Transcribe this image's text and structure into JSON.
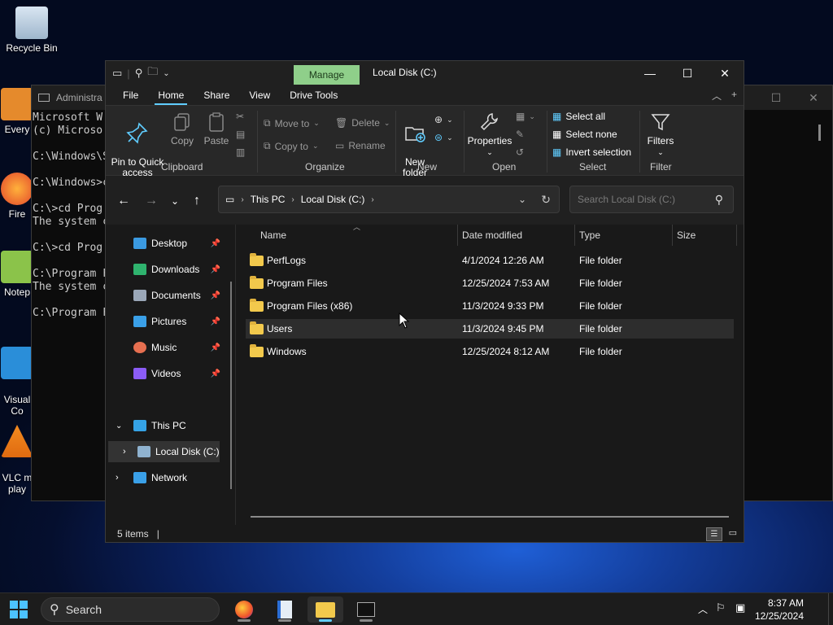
{
  "desktop": {
    "icons": [
      {
        "label": "Recycle Bin"
      },
      {
        "label": "Every"
      },
      {
        "label": "Fire"
      },
      {
        "label": "Notep"
      },
      {
        "label": "Visual\nCo"
      },
      {
        "label": "VLC m\nplay"
      }
    ]
  },
  "cmd": {
    "title": "Administra",
    "lines": "Microsoft W\n(c) Microso\n\nC:\\Windows\\S\n\nC:\\Windows>c\n\nC:\\>cd Prog\nThe system c\n\nC:\\>cd Prog\n\nC:\\Program F\nThe system c\n\nC:\\Program F"
  },
  "explorer": {
    "title": "Local Disk (C:)",
    "context_tab": "Manage",
    "menu": [
      "File",
      "Home",
      "Share",
      "View",
      "Drive Tools"
    ],
    "active_menu": "Home",
    "ribbon": {
      "clipboard": {
        "label": "Clipboard",
        "pin": "Pin to Quick\naccess",
        "copy": "Copy",
        "paste": "Paste"
      },
      "organize": {
        "label": "Organize",
        "move_to": "Move to",
        "copy_to": "Copy to",
        "delete": "Delete",
        "rename": "Rename"
      },
      "new": {
        "label": "New",
        "new_folder": "New\nfolder"
      },
      "open": {
        "label": "Open",
        "properties": "Properties"
      },
      "select": {
        "label": "Select",
        "select_all": "Select all",
        "select_none": "Select none",
        "invert": "Invert selection"
      },
      "filter": {
        "label": "Filter",
        "filters": "Filters"
      }
    },
    "address": {
      "crumbs": [
        "This PC",
        "Local Disk (C:)"
      ]
    },
    "search_placeholder": "Search Local Disk (C:)",
    "nav": {
      "quick": [
        {
          "label": "Desktop",
          "color": "#3b9ae1"
        },
        {
          "label": "Downloads",
          "color": "#2fb36e"
        },
        {
          "label": "Documents",
          "color": "#9aa7b8"
        },
        {
          "label": "Pictures",
          "color": "#3aa0e8"
        },
        {
          "label": "Music",
          "color": "#e66f50"
        },
        {
          "label": "Videos",
          "color": "#8b5cf6"
        }
      ],
      "this_pc": "This PC",
      "local_disk": "Local Disk (C:)",
      "network": "Network"
    },
    "columns": [
      "Name",
      "Date modified",
      "Type",
      "Size"
    ],
    "files": [
      {
        "name": "PerfLogs",
        "date": "4/1/2024 12:26 AM",
        "type": "File folder"
      },
      {
        "name": "Program Files",
        "date": "12/25/2024 7:53 AM",
        "type": "File folder"
      },
      {
        "name": "Program Files (x86)",
        "date": "11/3/2024 9:33 PM",
        "type": "File folder"
      },
      {
        "name": "Users",
        "date": "11/3/2024 9:45 PM",
        "type": "File folder"
      },
      {
        "name": "Windows",
        "date": "12/25/2024 8:12 AM",
        "type": "File folder"
      }
    ],
    "status": "5 items"
  },
  "taskbar": {
    "search": "Search",
    "time": "8:37 AM",
    "date": "12/25/2024"
  }
}
